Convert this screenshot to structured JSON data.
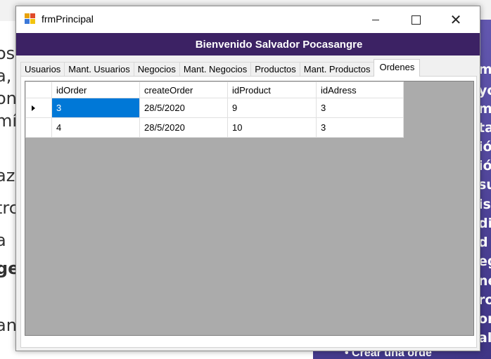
{
  "window": {
    "title": "frmPrincipal",
    "icon": "winforms-app-icon",
    "controls": {
      "minimize": "minimize-icon",
      "maximize": "maximize-icon",
      "close_glyph": "✕"
    }
  },
  "header": {
    "welcome": "Bienvenido Salvador Pocasangre"
  },
  "tabs": [
    {
      "label": "Usuarios",
      "active": false
    },
    {
      "label": "Mant. Usuarios",
      "active": false
    },
    {
      "label": "Negocios",
      "active": false
    },
    {
      "label": "Mant. Negocios",
      "active": false
    },
    {
      "label": "Productos",
      "active": false
    },
    {
      "label": "Mant. Productos",
      "active": false
    },
    {
      "label": "Ordenes",
      "active": true
    }
  ],
  "grid": {
    "columns": [
      "idOrder",
      "createOrder",
      "idProduct",
      "idAdress"
    ],
    "rows": [
      {
        "idOrder": "3",
        "createOrder": "28/5/2020",
        "idProduct": "9",
        "idAdress": "3",
        "current": true
      },
      {
        "idOrder": "4",
        "createOrder": "28/5/2020",
        "idProduct": "10",
        "idAdress": "3",
        "current": false
      }
    ]
  },
  "background": {
    "left_fragments": [
      "os",
      "a,",
      "on",
      "mír",
      "az",
      "trc",
      "a",
      "ge",
      "an"
    ],
    "right_fragments": [
      "m",
      "yc",
      "m",
      "ta",
      "ió",
      "ió",
      "su",
      "is",
      "di",
      "d",
      "eg",
      "ne",
      "ro",
      "or",
      "al"
    ],
    "bottom_text": "• Crear una orde"
  },
  "colors": {
    "header": "#3c2264",
    "selection": "#0078d7",
    "grid_bg": "#ababab"
  }
}
